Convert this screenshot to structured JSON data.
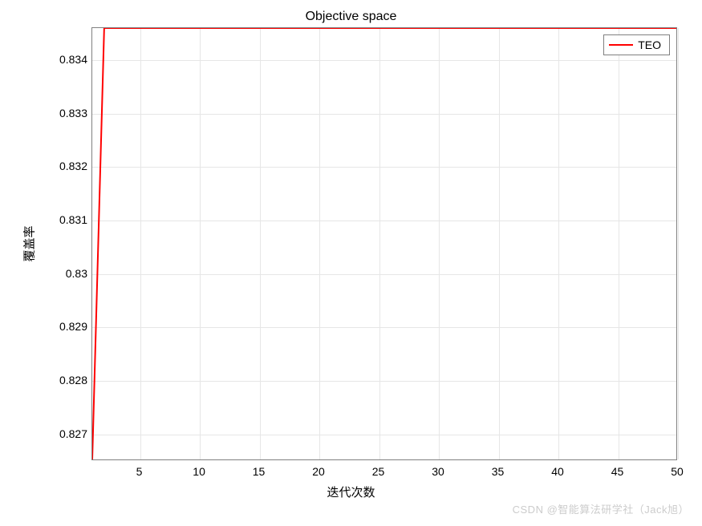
{
  "chart_data": {
    "type": "line",
    "title": "Objective space",
    "xlabel": "迭代次数",
    "ylabel": "覆盖率",
    "xlim": [
      1,
      50
    ],
    "ylim": [
      0.8265,
      0.8346
    ],
    "xticks": [
      5,
      10,
      15,
      20,
      25,
      30,
      35,
      40,
      45,
      50
    ],
    "yticks": [
      0.827,
      0.828,
      0.829,
      0.83,
      0.831,
      0.832,
      0.833,
      0.834
    ],
    "grid": true,
    "series": [
      {
        "name": "TEO",
        "color": "#ff0000",
        "x": [
          1,
          2,
          3,
          4,
          5,
          6,
          7,
          8,
          9,
          10,
          15,
          20,
          25,
          30,
          35,
          40,
          45,
          50
        ],
        "y": [
          0.8265,
          0.8346,
          0.8346,
          0.8346,
          0.8346,
          0.8346,
          0.8346,
          0.8346,
          0.8346,
          0.8346,
          0.8346,
          0.8346,
          0.8346,
          0.8346,
          0.8346,
          0.8346,
          0.8346,
          0.8346
        ]
      }
    ],
    "legend_position": "top-right"
  },
  "watermark": "CSDN @智能算法研学社（Jack旭）"
}
